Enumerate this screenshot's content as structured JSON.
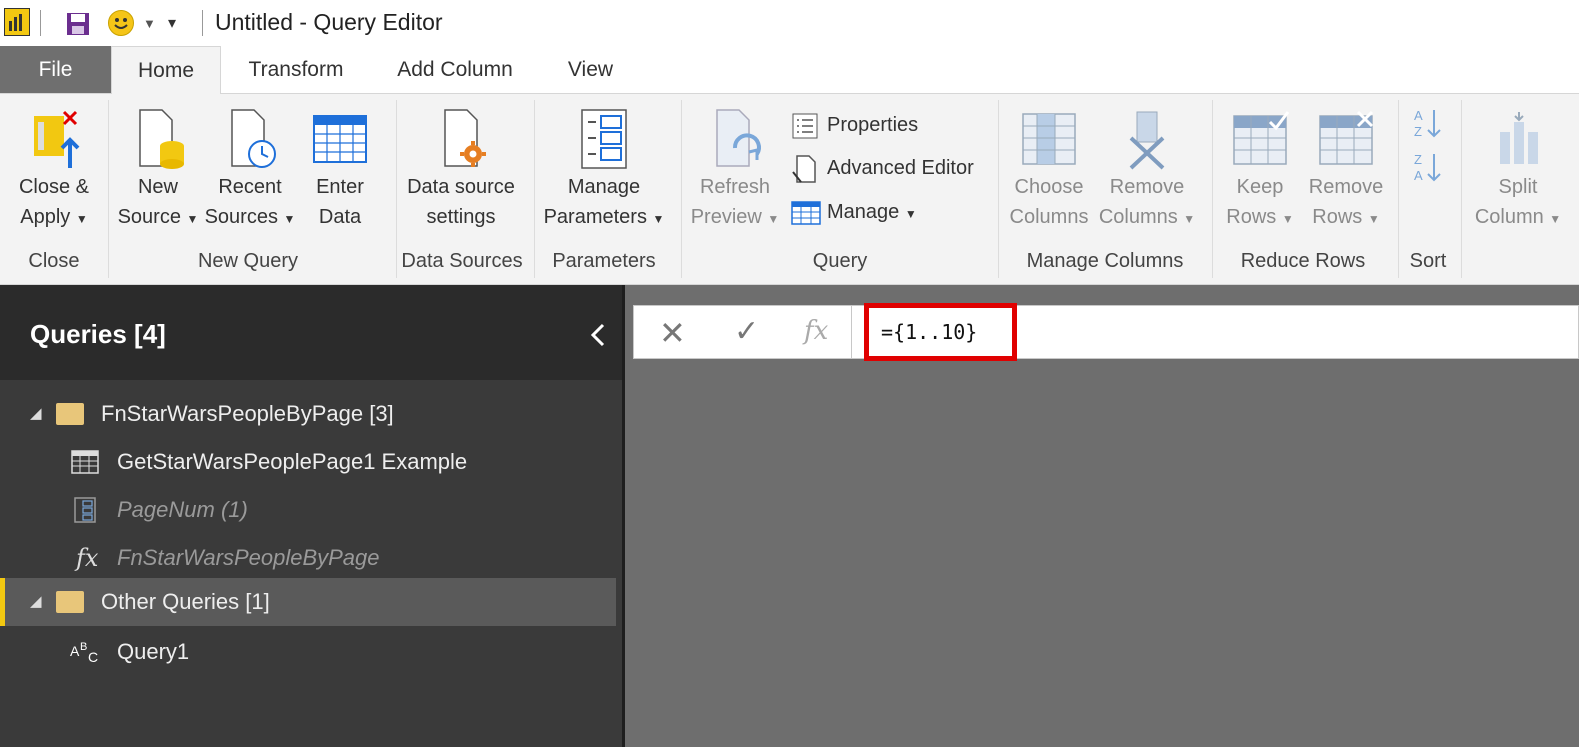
{
  "window": {
    "title": "Untitled - Query Editor"
  },
  "tabs": [
    "File",
    "Home",
    "Transform",
    "Add Column",
    "View"
  ],
  "ribbon": {
    "close_apply": {
      "line1": "Close &",
      "line2": "Apply",
      "group": "Close"
    },
    "new_source": {
      "line1": "New",
      "line2": "Source"
    },
    "recent_sources": {
      "line1": "Recent",
      "line2": "Sources"
    },
    "enter_data": {
      "line1": "Enter",
      "line2": "Data"
    },
    "new_query_group": "New Query",
    "data_source_settings": {
      "line1": "Data source",
      "line2": "settings",
      "group": "Data Sources"
    },
    "manage_parameters": {
      "line1": "Manage",
      "line2": "Parameters",
      "group": "Parameters"
    },
    "refresh_preview": {
      "line1": "Refresh",
      "line2": "Preview"
    },
    "properties": "Properties",
    "advanced_editor": "Advanced Editor",
    "manage": "Manage",
    "query_group": "Query",
    "choose_columns": {
      "line1": "Choose",
      "line2": "Columns"
    },
    "remove_columns": {
      "line1": "Remove",
      "line2": "Columns"
    },
    "manage_columns_group": "Manage Columns",
    "keep_rows": {
      "line1": "Keep",
      "line2": "Rows"
    },
    "remove_rows": {
      "line1": "Remove",
      "line2": "Rows"
    },
    "reduce_rows_group": "Reduce Rows",
    "sort_group": "Sort",
    "split_column": {
      "line1": "Split",
      "line2": "Column"
    }
  },
  "queries": {
    "header": "Queries [4]",
    "items": [
      {
        "label": "FnStarWarsPeopleByPage [3]",
        "type": "folder"
      },
      {
        "label": "GetStarWarsPeoplePage1 Example",
        "type": "table"
      },
      {
        "label": "PageNum (1)",
        "type": "parameter"
      },
      {
        "label": "FnStarWarsPeopleByPage",
        "type": "function",
        "icon_text": "fx"
      },
      {
        "label": "Other Queries [1]",
        "type": "folder"
      },
      {
        "label": "Query1",
        "type": "text"
      }
    ]
  },
  "formula_bar": {
    "fx": "fx",
    "value": "={1..10}"
  },
  "colors": {
    "accent": "#F2C811",
    "highlight": "#E00000"
  }
}
